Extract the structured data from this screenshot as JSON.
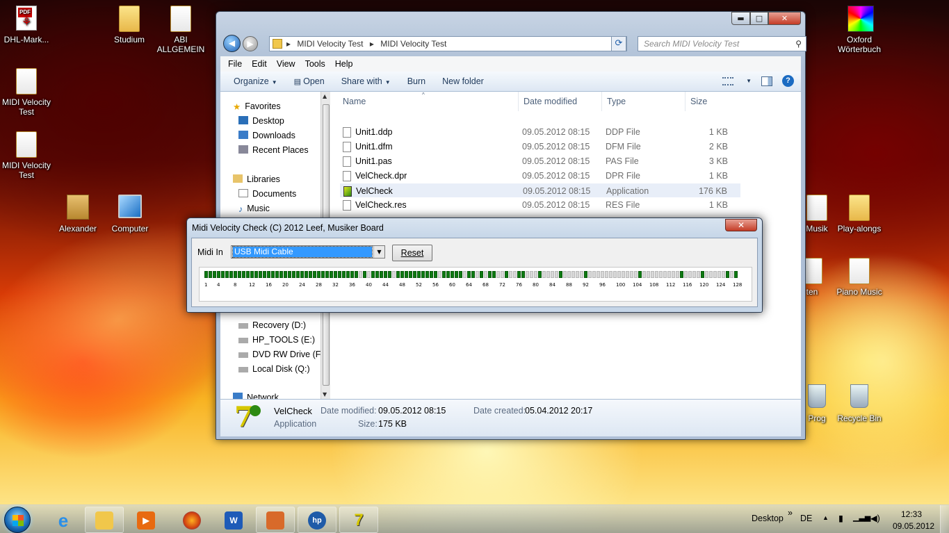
{
  "desktop": {
    "icons": [
      {
        "label": "DHL-Mark..."
      },
      {
        "label": "Studium"
      },
      {
        "label": "ABI ALLGEMEIN"
      },
      {
        "label": "Oxford Wörterbuch"
      },
      {
        "label": "MIDI Velocity Test"
      },
      {
        "label": "MIDI Velocity Test"
      },
      {
        "label": "Alexander"
      },
      {
        "label": "Computer"
      },
      {
        "label": "Musik"
      },
      {
        "label": "Play-alongs"
      },
      {
        "label": "ten"
      },
      {
        "label": "Piano Music"
      },
      {
        "label": "Prog"
      },
      {
        "label": "Recycle Bin"
      }
    ]
  },
  "explorer": {
    "window_buttons": {
      "minimize": "▬",
      "maximize": "□",
      "close": "✕"
    },
    "breadcrumb": [
      "MIDI Velocity Test",
      "MIDI Velocity Test"
    ],
    "breadcrumb_sep": "▸",
    "search_placeholder": "Search MIDI Velocity Test",
    "menu": [
      "File",
      "Edit",
      "View",
      "Tools",
      "Help"
    ],
    "toolbar": {
      "organize": "Organize",
      "open": "Open",
      "share_with": "Share with",
      "burn": "Burn",
      "new_folder": "New folder"
    },
    "nav": {
      "favorites_header": "Favorites",
      "favorites": [
        "Desktop",
        "Downloads",
        "Recent Places"
      ],
      "libraries_header": "Libraries",
      "libraries": [
        "Documents",
        "Music"
      ],
      "drives": [
        "Recovery (D:)",
        "HP_TOOLS (E:)",
        "DVD RW Drive (F",
        "Local Disk (Q:)"
      ],
      "network": "Network"
    },
    "columns": {
      "name": "Name",
      "date": "Date modified",
      "type": "Type",
      "size": "Size"
    },
    "files": [
      {
        "name": "Unit1.ddp",
        "date": "09.05.2012 08:15",
        "type": "DDP File",
        "size": "1 KB"
      },
      {
        "name": "Unit1.dfm",
        "date": "09.05.2012 08:15",
        "type": "DFM File",
        "size": "2 KB"
      },
      {
        "name": "Unit1.pas",
        "date": "09.05.2012 08:15",
        "type": "PAS File",
        "size": "3 KB"
      },
      {
        "name": "VelCheck.dpr",
        "date": "09.05.2012 08:15",
        "type": "DPR File",
        "size": "1 KB"
      },
      {
        "name": "VelCheck",
        "date": "09.05.2012 08:15",
        "type": "Application",
        "size": "176 KB"
      },
      {
        "name": "VelCheck.res",
        "date": "09.05.2012 08:15",
        "type": "RES File",
        "size": "1 KB"
      }
    ],
    "details": {
      "name": "VelCheck",
      "kind": "Application",
      "modified_label": "Date modified:",
      "modified_value": "09.05.2012 08:15",
      "size_label": "Size:",
      "size_value": "175 KB",
      "created_label": "Date created:",
      "created_value": "05.04.2012 20:17"
    }
  },
  "midi_dialog": {
    "title": "Midi Velocity Check (C) 2012 Leef, Musiker Board",
    "close": "✕",
    "midi_in_label": "Midi In",
    "midi_in_value": "USB Midi Cable",
    "reset_label": "Reset",
    "velocity_cells_on": [
      1,
      1,
      1,
      1,
      1,
      1,
      1,
      1,
      1,
      1,
      1,
      1,
      1,
      1,
      1,
      1,
      1,
      1,
      1,
      1,
      1,
      1,
      1,
      1,
      1,
      1,
      1,
      1,
      1,
      1,
      1,
      1,
      1,
      1,
      1,
      1,
      1,
      0,
      1,
      0,
      1,
      1,
      1,
      1,
      1,
      0,
      1,
      1,
      1,
      1,
      1,
      1,
      1,
      1,
      1,
      1,
      0,
      1,
      1,
      1,
      1,
      1,
      0,
      1,
      1,
      0,
      1,
      0,
      1,
      1,
      0,
      0,
      1,
      0,
      0,
      1,
      1,
      0,
      0,
      0,
      1,
      0,
      0,
      0,
      0,
      1,
      0,
      0,
      0,
      0,
      0,
      1,
      0,
      0,
      0,
      0,
      0,
      0,
      0,
      0,
      0,
      0,
      0,
      0,
      1,
      0,
      0,
      0,
      0,
      0,
      0,
      0,
      0,
      0,
      1,
      0,
      0,
      0,
      0,
      1,
      0,
      0,
      0,
      0,
      0,
      1,
      0,
      1
    ],
    "tick_labels": [
      "1",
      "4",
      "8",
      "12",
      "16",
      "20",
      "24",
      "28",
      "32",
      "36",
      "40",
      "44",
      "48",
      "52",
      "56",
      "60",
      "64",
      "68",
      "72",
      "76",
      "80",
      "84",
      "88",
      "92",
      "96",
      "100",
      "104",
      "108",
      "112",
      "116",
      "120",
      "124",
      "128"
    ]
  },
  "taskbar": {
    "apps": [
      "explorer",
      "media-player",
      "firefox",
      "word",
      "remote",
      "hp",
      "velcheck"
    ],
    "desktop_label": "Desktop",
    "chevron": "»",
    "lang": "DE",
    "time": "12:33",
    "date": "09.05.2012"
  }
}
